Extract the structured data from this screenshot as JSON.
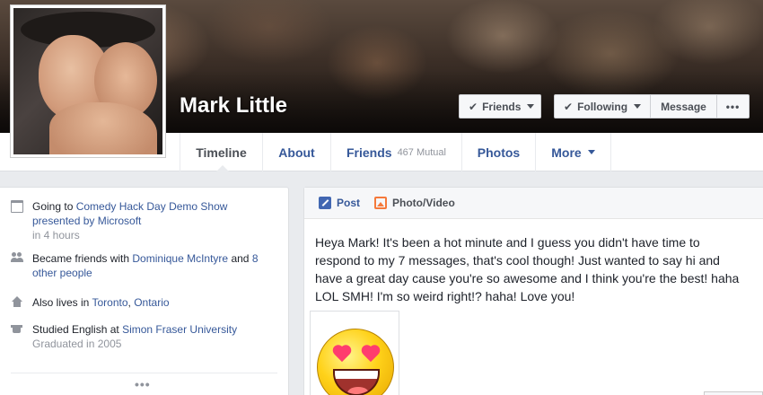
{
  "profile": {
    "name": "Mark Little"
  },
  "cover_buttons": {
    "friends": "Friends",
    "following": "Following",
    "message": "Message",
    "more": "•••"
  },
  "tabs": [
    {
      "label": "Timeline",
      "active": true
    },
    {
      "label": "About"
    },
    {
      "label": "Friends",
      "count": "467 Mutual"
    },
    {
      "label": "Photos"
    },
    {
      "label": "More"
    }
  ],
  "intro": {
    "event": {
      "prefix": "Going to ",
      "link": "Comedy Hack Day Demo Show presented by Microsoft",
      "time": "in 4 hours"
    },
    "friends": {
      "prefix": "Became friends with ",
      "link1": "Dominique McIntyre",
      "mid": " and ",
      "link2": "8 other people"
    },
    "lives": {
      "prefix": "Also lives in ",
      "link1": "Toronto",
      "sep": ", ",
      "link2": "Ontario"
    },
    "studied": {
      "prefix": "Studied English at ",
      "link": "Simon Fraser University",
      "sub": "Graduated in 2005"
    },
    "see_more": "•••"
  },
  "composer": {
    "tab_post": "Post",
    "tab_photo": "Photo/Video",
    "text": "Heya Mark! It's been a hot minute and I guess you didn't have time to respond to my 7 messages, that's cool though! Just wanted to say hi and have a great day cause you're so awesome and I think you're the best! haha LOL SMH! I'm so weird right!? haha! Love you!"
  },
  "icons": {
    "event": "calendar-icon",
    "friends": "people-icon",
    "lives": "home-icon",
    "studied": "school-icon",
    "post": "pencil-icon",
    "photo": "photo-icon",
    "check": "check-icon"
  },
  "colors": {
    "link": "#365899",
    "muted": "#90949c",
    "page_bg": "#e9ebee",
    "accent": "#4267b2"
  }
}
